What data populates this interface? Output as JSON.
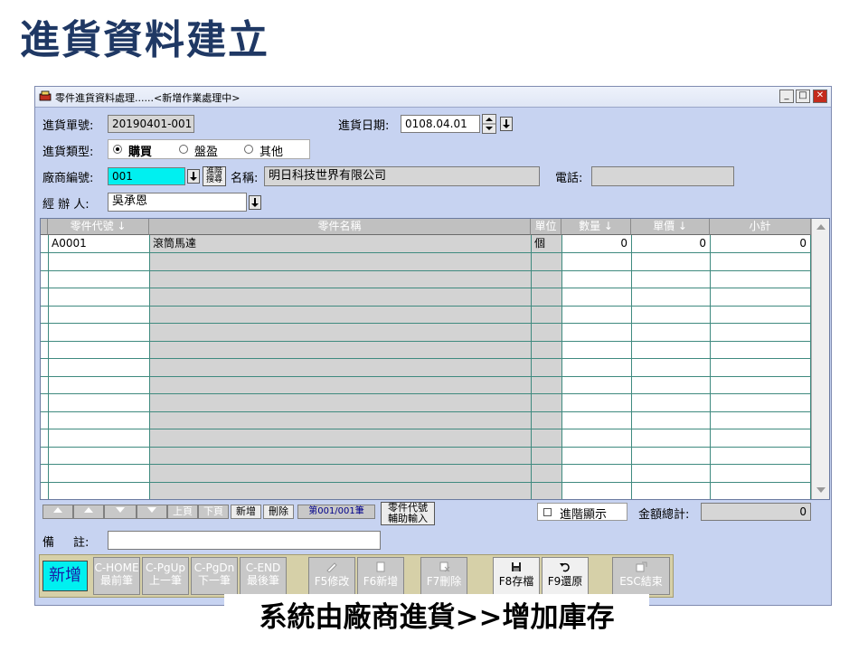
{
  "slide_title": "進貨資料建立",
  "window": {
    "title": "零件進貨資料處理......<新增作業處理中>",
    "min_label": "_",
    "max_label": "□",
    "close_label": "✕"
  },
  "form": {
    "order_no_label": "進貨單號:",
    "order_no": "20190401-001",
    "date_label": "進貨日期:",
    "date": "0108.04.01",
    "type_label": "進貨類型:",
    "type_options": [
      "購買",
      "盤盈",
      "其他"
    ],
    "vendor_label": "廠商編號:",
    "vendor_no": "001",
    "adv_search_line1": "進階",
    "adv_search_line2": "搜尋",
    "name_label": "名稱:",
    "vendor_name": "明日科技世界有限公司",
    "phone_label": "電話:",
    "phone": "",
    "handler_label": "經 辦 人:",
    "handler": "吳承恩"
  },
  "grid": {
    "columns": [
      "零件代號 ↓",
      "零件名稱",
      "單位",
      "數量 ↓",
      "單價 ↓",
      "小計"
    ],
    "rows": [
      [
        "A0001",
        "滾筒馬達",
        "個",
        "0",
        "0",
        "0"
      ]
    ]
  },
  "nav": {
    "prev_page": "上頁",
    "next_page": "下頁",
    "add": "新增",
    "delete": "刪除",
    "counter": "第001/001筆",
    "part_helper_line1": "零件代號",
    "part_helper_line2": "輔助輸入",
    "advanced_display": "進階顯示",
    "total_label": "金額總計:",
    "total": "0"
  },
  "remark": {
    "label_a": "備",
    "label_b": "註:",
    "value": ""
  },
  "toolbar": {
    "mode": "新增",
    "keys": [
      {
        "line1": "C-HOME",
        "line2": "最前筆"
      },
      {
        "line1": "C-PgUp",
        "line2": "上一筆"
      },
      {
        "line1": "C-PgDn",
        "line2": "下一筆"
      },
      {
        "line1": "C-END",
        "line2": "最後筆"
      },
      {
        "line1": "F5修改"
      },
      {
        "line1": "F6新增"
      },
      {
        "line1": "F7刪除"
      },
      {
        "line1": "F8存檔"
      },
      {
        "line1": "F9還原"
      },
      {
        "line1": "ESC結束"
      }
    ]
  },
  "caption": "系統由廠商進貨>>增加庫存",
  "colors": {
    "window_bg": "#c7d3f1",
    "title_text": "#1f3864",
    "vendor_field": "#00f0f0",
    "mode_button": "#00f0f0",
    "grid_line": "#3f8a7f"
  },
  "icons": [
    "app-icon",
    "spinner-icon",
    "dropdown-arrow-icon",
    "scroll-up-icon",
    "scroll-down-icon",
    "save-icon",
    "undo-icon",
    "edit-icon",
    "new-doc-icon",
    "delete-icon",
    "exit-icon"
  ]
}
